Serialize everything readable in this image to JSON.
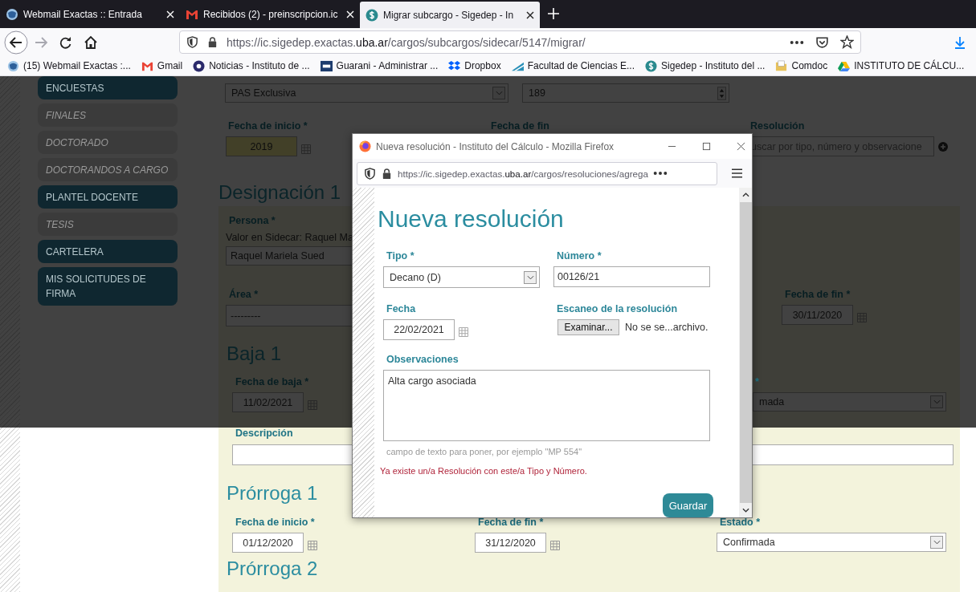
{
  "browser": {
    "tabs": [
      {
        "title": "Webmail Exactas :: Entrada",
        "kind": "globe",
        "selected": false
      },
      {
        "title": "Recibidos (2) - preinscripcion.ic",
        "kind": "gmail",
        "selected": false
      },
      {
        "title": "Migrar subcargo - Sigedep - In",
        "kind": "sigedep",
        "selected": true
      }
    ],
    "url": {
      "before": "https://ic.sigedep.exactas.",
      "domain": "uba.ar",
      "after": "/cargos/subcargos/sidecar/5147/migrar/"
    },
    "bookmarks": [
      {
        "label": "(15) Webmail Exactas :...",
        "kind": "globe"
      },
      {
        "label": "Gmail",
        "kind": "gmail"
      },
      {
        "label": "Noticias - Instituto de ...",
        "kind": "ic"
      },
      {
        "label": "Guarani - Administrar ...",
        "kind": "siu"
      },
      {
        "label": "Dropbox",
        "kind": "dropbox"
      },
      {
        "label": "Facultad de Ciencias E...",
        "kind": "faculty"
      },
      {
        "label": "Sigedep - Instituto del ...",
        "kind": "sigedep"
      },
      {
        "label": "Comdoc",
        "kind": "folder"
      },
      {
        "label": "INSTITUTO DE CÁLCU...",
        "kind": "drive"
      }
    ]
  },
  "sidebar": {
    "items": [
      {
        "label": "ENCUESTAS",
        "disabled": false
      },
      {
        "label": "FINALES",
        "disabled": true
      },
      {
        "label": "DOCTORADO",
        "disabled": true
      },
      {
        "label": "DOCTORANDOS A CARGO",
        "disabled": true
      },
      {
        "label": "PLANTEL DOCENTE",
        "disabled": false
      },
      {
        "label": "TESIS",
        "disabled": true
      },
      {
        "label": "CARTELERA",
        "disabled": false
      },
      {
        "label": "MIS SOLICITUDES DE FIRMA",
        "disabled": false
      }
    ]
  },
  "form": {
    "cargo_value": "PAS Exclusiva",
    "number_value": "189",
    "fecha_inicio": {
      "label": "Fecha de inicio *",
      "value": "2019",
      "highlighted": true
    },
    "fecha_fin": {
      "label": "Fecha de fin"
    },
    "resolucion": {
      "label": "Resolución",
      "placeholder": "uscar por tipo, número y observacione"
    },
    "designacion": {
      "title": "Designación 1",
      "persona_label": "Persona *",
      "sidecar_note": "Valor en Sidecar: Raquel Ma",
      "persona_value": "Raquel Mariela Sued",
      "area_label": "Área *",
      "area_value": "---------",
      "fin_label": "Fecha de fin *",
      "fin_value": "30/11/2020"
    },
    "baja": {
      "title": "Baja 1",
      "fecha_label": "Fecha de baja *",
      "fecha_value": "11/02/2021",
      "estado_label": "*",
      "estado_value": "mada",
      "descripcion_label": "Descripción"
    },
    "prorrogas": [
      {
        "title": "Prórroga 1",
        "inicio_label": "Fecha de inicio *",
        "inicio_value": "01/12/2020",
        "fin_label": "Fecha de fin *",
        "fin_value": "31/12/2020",
        "estado_label": "Estado *",
        "estado_value": "Confirmada"
      },
      {
        "title": "Prórroga 2"
      }
    ]
  },
  "popup": {
    "title": "Nueva resolución - Instituto del Cálculo - Mozilla Firefox",
    "url": {
      "before": "https://ic.sigedep.exactas.",
      "domain": "uba.ar",
      "after": "/cargos/resoluciones/agrega"
    },
    "heading": "Nueva resolución",
    "tipo_label": "Tipo *",
    "tipo_value": "Decano (D)",
    "numero_label": "Número *",
    "numero_value": "00126/21",
    "fecha_label": "Fecha",
    "fecha_value": "22/02/2021",
    "escaneo_label": "Escaneo de la resolución",
    "browse_button": "Examinar...",
    "file_status": "No se se...archivo.",
    "observaciones_label": "Observaciones",
    "observaciones_value": "Alta cargo asociada",
    "help": "campo de texto para poner, por ejemplo \"MP 554\"",
    "error": "Ya existe un/a Resolución con este/a Tipo y Número.",
    "save_button": "Guardar"
  }
}
